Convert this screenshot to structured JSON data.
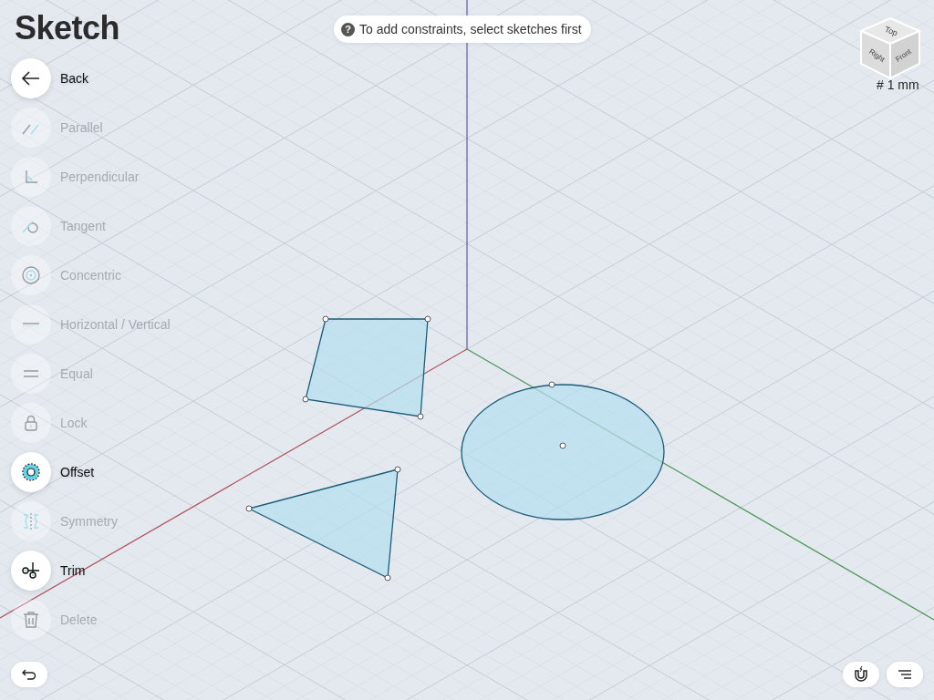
{
  "title": "Sketch",
  "hint": {
    "icon": "?",
    "text": "To add constraints, select sketches first"
  },
  "tools": [
    {
      "label": "Back",
      "enabled": true
    },
    {
      "label": "Parallel",
      "enabled": false
    },
    {
      "label": "Perpendicular",
      "enabled": false
    },
    {
      "label": "Tangent",
      "enabled": false
    },
    {
      "label": "Concentric",
      "enabled": false
    },
    {
      "label": "Horizontal / Vertical",
      "enabled": false
    },
    {
      "label": "Equal",
      "enabled": false
    },
    {
      "label": "Lock",
      "enabled": false
    },
    {
      "label": "Offset",
      "enabled": true
    },
    {
      "label": "Symmetry",
      "enabled": false
    },
    {
      "label": "Trim",
      "enabled": true
    },
    {
      "label": "Delete",
      "enabled": false
    }
  ],
  "view_cube": {
    "faces": [
      "Top",
      "Right",
      "Front"
    ],
    "grid_size": "# 1 mm"
  },
  "sketches": [
    {
      "kind": "quadrilateral"
    },
    {
      "kind": "triangle"
    },
    {
      "kind": "circle"
    }
  ]
}
